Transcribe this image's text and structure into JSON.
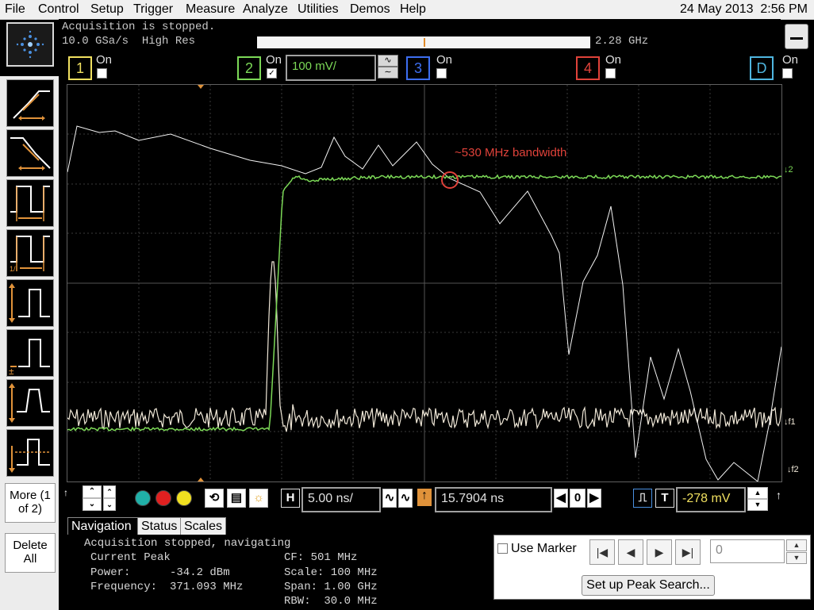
{
  "menu": {
    "items": [
      "File",
      "Control",
      "Setup",
      "Trigger",
      "Measure",
      "Analyze",
      "Utilities",
      "Demos",
      "Help"
    ],
    "date": "24 May 2013",
    "time": "2:56 PM"
  },
  "status": {
    "acquisition": "Acquisition is stopped.",
    "sample_rate": "10.0 GSa/s",
    "mode": "High Res",
    "bandwidth": "2.28 GHz"
  },
  "channels": [
    {
      "num": "1",
      "state": "On",
      "checked": false,
      "color": "#f0e060"
    },
    {
      "num": "2",
      "state": "On",
      "checked": true,
      "color": "#7cd957",
      "scale": "100 mV/"
    },
    {
      "num": "3",
      "state": "On",
      "checked": false,
      "color": "#3d6ef0"
    },
    {
      "num": "4",
      "state": "On",
      "checked": false,
      "color": "#e0423a"
    },
    {
      "num": "D",
      "state": "On",
      "checked": false,
      "color": "#4fb6e0"
    }
  ],
  "annotation": "~530 MHz bandwidth",
  "right_markers": {
    "m2": "2",
    "f1": "f1",
    "f2": "f2"
  },
  "horizontal": {
    "h_label": "H",
    "time_scale": "5.00 ns/",
    "position": "15.7904 ns",
    "zero": "0",
    "t_label": "T",
    "trigger_level": "-278 mV"
  },
  "left_toolbar": {
    "more": "More (1 of 2)",
    "delete_all": "Delete All"
  },
  "tabs": [
    "Navigation",
    "Status",
    "Scales"
  ],
  "info": {
    "state": "Acquisition stopped, navigating",
    "current_peak": "Current Peak",
    "power_label": "Power:",
    "power_value": "-34.2 dBm",
    "freq_label": "Frequency:",
    "freq_value": "371.093 MHz",
    "cf": "CF: 501 MHz",
    "scale": "Scale: 100 MHz",
    "span": "Span: 1.00 GHz",
    "rbw": "RBW:  30.0 MHz"
  },
  "marker": {
    "use_marker": "Use Marker",
    "value": "0",
    "peak_search": "Set up Peak Search..."
  },
  "colors": {
    "ch2_trace": "#7cd957",
    "fft_trace": "#f0e8d8",
    "white_trace": "#f2f2f2",
    "annotation": "#e0423a"
  }
}
